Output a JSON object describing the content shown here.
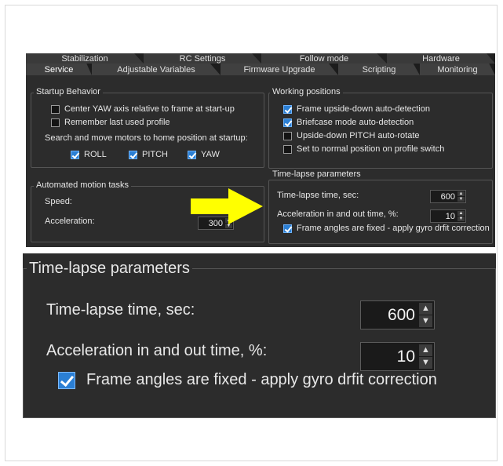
{
  "tabs_row1": [
    "Stabilization",
    "RC Settings",
    "Follow mode",
    "Hardware"
  ],
  "tabs_row2": [
    "Service",
    "Adjustable Variables",
    "Firmware Upgrade",
    "Scripting",
    "Monitoring"
  ],
  "active_tab": "Service",
  "startup": {
    "title": "Startup Behavior",
    "center_yaw": "Center YAW axis relative to frame at start-up",
    "remember_profile": "Remember last used profile",
    "search_label": "Search and move motors to home position at startup:",
    "roll": "ROLL",
    "pitch": "PITCH",
    "yaw": "YAW"
  },
  "working": {
    "title": "Working positions",
    "upside_down": "Frame upside-down auto-detection",
    "briefcase": "Briefcase mode auto-detection",
    "pitch_rotate": "Upside-down PITCH auto-rotate",
    "normal_position": "Set to normal position on profile switch"
  },
  "motion": {
    "title": "Automated motion tasks",
    "speed": "Speed:",
    "acceleration": "Acceleration:",
    "acceleration_value": "300"
  },
  "timelapse": {
    "title": "Time-lapse parameters",
    "time_label": "Time-lapse time, sec:",
    "time_value": "600",
    "accel_label": "Acceleration in and out time, %:",
    "accel_value": "10",
    "fixed_label": "Frame angles are fixed - apply gyro drfit correction"
  },
  "colors": {
    "accent": "#2b7fd4",
    "panel": "#2c2c2c",
    "arrow": "#ffff00"
  }
}
